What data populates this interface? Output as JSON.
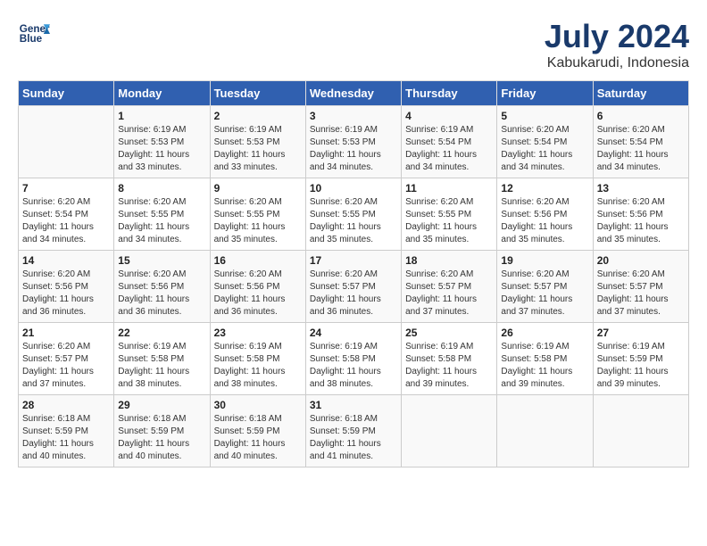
{
  "header": {
    "logo_line1": "General",
    "logo_line2": "Blue",
    "month": "July 2024",
    "location": "Kabukarudi, Indonesia"
  },
  "days_of_week": [
    "Sunday",
    "Monday",
    "Tuesday",
    "Wednesday",
    "Thursday",
    "Friday",
    "Saturday"
  ],
  "weeks": [
    [
      {
        "day": "",
        "info": ""
      },
      {
        "day": "1",
        "info": "Sunrise: 6:19 AM\nSunset: 5:53 PM\nDaylight: 11 hours\nand 33 minutes."
      },
      {
        "day": "2",
        "info": "Sunrise: 6:19 AM\nSunset: 5:53 PM\nDaylight: 11 hours\nand 33 minutes."
      },
      {
        "day": "3",
        "info": "Sunrise: 6:19 AM\nSunset: 5:53 PM\nDaylight: 11 hours\nand 34 minutes."
      },
      {
        "day": "4",
        "info": "Sunrise: 6:19 AM\nSunset: 5:54 PM\nDaylight: 11 hours\nand 34 minutes."
      },
      {
        "day": "5",
        "info": "Sunrise: 6:20 AM\nSunset: 5:54 PM\nDaylight: 11 hours\nand 34 minutes."
      },
      {
        "day": "6",
        "info": "Sunrise: 6:20 AM\nSunset: 5:54 PM\nDaylight: 11 hours\nand 34 minutes."
      }
    ],
    [
      {
        "day": "7",
        "info": "Sunrise: 6:20 AM\nSunset: 5:54 PM\nDaylight: 11 hours\nand 34 minutes."
      },
      {
        "day": "8",
        "info": "Sunrise: 6:20 AM\nSunset: 5:55 PM\nDaylight: 11 hours\nand 34 minutes."
      },
      {
        "day": "9",
        "info": "Sunrise: 6:20 AM\nSunset: 5:55 PM\nDaylight: 11 hours\nand 35 minutes."
      },
      {
        "day": "10",
        "info": "Sunrise: 6:20 AM\nSunset: 5:55 PM\nDaylight: 11 hours\nand 35 minutes."
      },
      {
        "day": "11",
        "info": "Sunrise: 6:20 AM\nSunset: 5:55 PM\nDaylight: 11 hours\nand 35 minutes."
      },
      {
        "day": "12",
        "info": "Sunrise: 6:20 AM\nSunset: 5:56 PM\nDaylight: 11 hours\nand 35 minutes."
      },
      {
        "day": "13",
        "info": "Sunrise: 6:20 AM\nSunset: 5:56 PM\nDaylight: 11 hours\nand 35 minutes."
      }
    ],
    [
      {
        "day": "14",
        "info": "Sunrise: 6:20 AM\nSunset: 5:56 PM\nDaylight: 11 hours\nand 36 minutes."
      },
      {
        "day": "15",
        "info": "Sunrise: 6:20 AM\nSunset: 5:56 PM\nDaylight: 11 hours\nand 36 minutes."
      },
      {
        "day": "16",
        "info": "Sunrise: 6:20 AM\nSunset: 5:56 PM\nDaylight: 11 hours\nand 36 minutes."
      },
      {
        "day": "17",
        "info": "Sunrise: 6:20 AM\nSunset: 5:57 PM\nDaylight: 11 hours\nand 36 minutes."
      },
      {
        "day": "18",
        "info": "Sunrise: 6:20 AM\nSunset: 5:57 PM\nDaylight: 11 hours\nand 37 minutes."
      },
      {
        "day": "19",
        "info": "Sunrise: 6:20 AM\nSunset: 5:57 PM\nDaylight: 11 hours\nand 37 minutes."
      },
      {
        "day": "20",
        "info": "Sunrise: 6:20 AM\nSunset: 5:57 PM\nDaylight: 11 hours\nand 37 minutes."
      }
    ],
    [
      {
        "day": "21",
        "info": "Sunrise: 6:20 AM\nSunset: 5:57 PM\nDaylight: 11 hours\nand 37 minutes."
      },
      {
        "day": "22",
        "info": "Sunrise: 6:19 AM\nSunset: 5:58 PM\nDaylight: 11 hours\nand 38 minutes."
      },
      {
        "day": "23",
        "info": "Sunrise: 6:19 AM\nSunset: 5:58 PM\nDaylight: 11 hours\nand 38 minutes."
      },
      {
        "day": "24",
        "info": "Sunrise: 6:19 AM\nSunset: 5:58 PM\nDaylight: 11 hours\nand 38 minutes."
      },
      {
        "day": "25",
        "info": "Sunrise: 6:19 AM\nSunset: 5:58 PM\nDaylight: 11 hours\nand 39 minutes."
      },
      {
        "day": "26",
        "info": "Sunrise: 6:19 AM\nSunset: 5:58 PM\nDaylight: 11 hours\nand 39 minutes."
      },
      {
        "day": "27",
        "info": "Sunrise: 6:19 AM\nSunset: 5:59 PM\nDaylight: 11 hours\nand 39 minutes."
      }
    ],
    [
      {
        "day": "28",
        "info": "Sunrise: 6:18 AM\nSunset: 5:59 PM\nDaylight: 11 hours\nand 40 minutes."
      },
      {
        "day": "29",
        "info": "Sunrise: 6:18 AM\nSunset: 5:59 PM\nDaylight: 11 hours\nand 40 minutes."
      },
      {
        "day": "30",
        "info": "Sunrise: 6:18 AM\nSunset: 5:59 PM\nDaylight: 11 hours\nand 40 minutes."
      },
      {
        "day": "31",
        "info": "Sunrise: 6:18 AM\nSunset: 5:59 PM\nDaylight: 11 hours\nand 41 minutes."
      },
      {
        "day": "",
        "info": ""
      },
      {
        "day": "",
        "info": ""
      },
      {
        "day": "",
        "info": ""
      }
    ]
  ]
}
